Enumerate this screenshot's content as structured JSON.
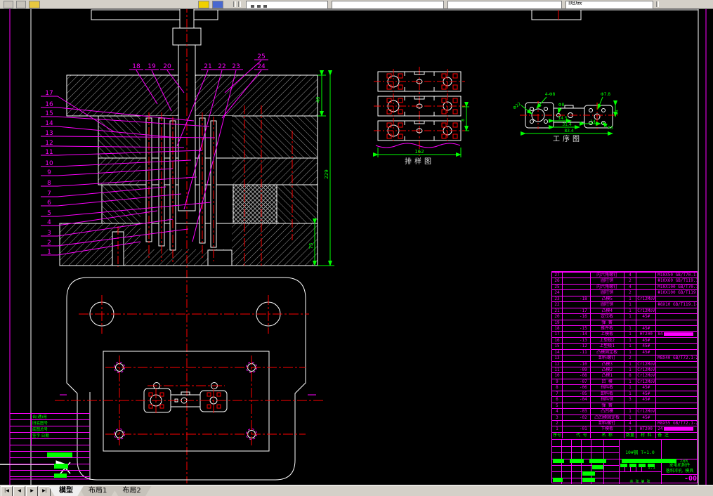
{
  "toolbar": {
    "combo_text": "随层",
    "icons": [
      "toolbar-icon",
      "toolbar-icon",
      "paint-icon",
      "match-icon",
      "preview-icon"
    ]
  },
  "tab_bar": {
    "nav": [
      "|◀",
      "◀",
      "▶",
      "▶|"
    ],
    "tabs": [
      "模型",
      "布局1",
      "布局2"
    ],
    "active_tab": "模型"
  },
  "drawing": {
    "balloons_left": [
      "17",
      "16",
      "15",
      "14",
      "13",
      "12",
      "11",
      "10",
      "9",
      "8",
      "7",
      "6",
      "5",
      "4",
      "3",
      "2",
      "1"
    ],
    "balloons_top": [
      "18",
      "19",
      "20",
      "21",
      "22",
      "23",
      "24",
      "25"
    ],
    "main_dims": {
      "top": "40",
      "overall": "229",
      "bottom": "75"
    },
    "strip_view": {
      "label": "排样图",
      "width_dim": "162",
      "right_dim": "8"
    },
    "process_view": {
      "label": "工序图",
      "dims": {
        "holes": "4-Φ8",
        "left_dia": "Φ22",
        "mid_dia": "Φ8",
        "right_dia": "Φ7.8",
        "d1": "14.5",
        "d2": "31.4",
        "d3": "83.4",
        "d4": "14",
        "radius": "R5",
        "height": "13"
      }
    },
    "bom": {
      "headers": [
        "序号",
        "代 号",
        "名 称",
        "数量",
        "材 料",
        "备 注"
      ],
      "rows": [
        {
          "no": "27",
          "code": "",
          "name": "内六角螺钉",
          "qty": "4",
          "mat": "",
          "remark": "M10X50 GB/T70.1-2000",
          "hl": false
        },
        {
          "no": "26",
          "code": "",
          "name": "圆柱销",
          "qty": "2",
          "mat": "",
          "remark": "Φ10X60 GB/T119.1-2000",
          "hl": false
        },
        {
          "no": "25",
          "code": "",
          "name": "内六角螺钉",
          "qty": "4",
          "mat": "",
          "remark": "M10X100 GB/T70.1-2000",
          "hl": false
        },
        {
          "no": "24",
          "code": "",
          "name": "圆柱销",
          "qty": "2",
          "mat": "",
          "remark": "Φ10X100 GB/T119.1-2000",
          "hl": false
        },
        {
          "no": "23",
          "code": "-18",
          "name": "凸模5",
          "qty": "1",
          "mat": "Cr12MoV",
          "remark": "",
          "hl": false
        },
        {
          "no": "22",
          "code": "",
          "name": "圆柱销",
          "qty": "1",
          "mat": "",
          "remark": "Φ8X10 GB/T119.1-2000",
          "hl": false
        },
        {
          "no": "21",
          "code": "-17",
          "name": "凸模4",
          "qty": "1",
          "mat": "Cr12MoV",
          "remark": "",
          "hl": false
        },
        {
          "no": "20",
          "code": "-16",
          "name": "定位板",
          "qty": "1",
          "mat": "45#",
          "remark": "",
          "hl": false
        },
        {
          "no": "19",
          "code": "",
          "name": "弹  簧",
          "qty": "",
          "mat": "",
          "remark": "",
          "hl": false
        },
        {
          "no": "18",
          "code": "-15",
          "name": "推件板",
          "qty": "1",
          "mat": "45#",
          "remark": "",
          "hl": false
        },
        {
          "no": "17",
          "code": "-14",
          "name": "上模板",
          "qty": "1",
          "mat": "HT200",
          "remark": "84",
          "hl": true
        },
        {
          "no": "16",
          "code": "-13",
          "name": "上垫板2",
          "qty": "1",
          "mat": "45#",
          "remark": "",
          "hl": false
        },
        {
          "no": "15",
          "code": "-12",
          "name": "上垫板1",
          "qty": "1",
          "mat": "45#",
          "remark": "",
          "hl": false
        },
        {
          "no": "14",
          "code": "-11",
          "name": "凸模固定板",
          "qty": "1",
          "mat": "45#",
          "remark": "",
          "hl": false
        },
        {
          "no": "13",
          "code": "",
          "name": "卸料螺钉",
          "qty": "2",
          "mat": "",
          "remark": "M8X40 GB/T72.1-2000",
          "hl": false
        },
        {
          "no": "12",
          "code": "-10",
          "name": "凸模3",
          "qty": "1",
          "mat": "Cr12MoV",
          "remark": "",
          "hl": false
        },
        {
          "no": "11",
          "code": "-09",
          "name": "凸模2",
          "qty": "1",
          "mat": "Cr12MoV",
          "remark": "",
          "hl": false
        },
        {
          "no": "10",
          "code": "-08",
          "name": "凸模1",
          "qty": "8",
          "mat": "Cr12MoV",
          "remark": "",
          "hl": false
        },
        {
          "no": "9",
          "code": "-07",
          "name": "凹  模",
          "qty": "1",
          "mat": "Cr12MoV",
          "remark": "",
          "hl": false
        },
        {
          "no": "8",
          "code": "-06",
          "name": "挡料板",
          "qty": "1",
          "mat": "45#",
          "remark": "",
          "hl": false
        },
        {
          "no": "7",
          "code": "-05",
          "name": "卸料板",
          "qty": "1",
          "mat": "45#",
          "remark": "",
          "hl": false
        },
        {
          "no": "6",
          "code": "-04",
          "name": "挡料销",
          "qty": "3",
          "mat": "45#",
          "remark": "",
          "hl": false
        },
        {
          "no": "5",
          "code": "",
          "name": "弹  簧",
          "qty": "",
          "mat": "",
          "remark": "",
          "hl": false
        },
        {
          "no": "4",
          "code": "-03",
          "name": "凸凹模",
          "qty": "1",
          "mat": "Cr12MoV",
          "remark": "",
          "hl": false
        },
        {
          "no": "3",
          "code": "-02",
          "name": "凸凹模固定板",
          "qty": "1",
          "mat": "45#",
          "remark": "",
          "hl": false
        },
        {
          "no": "2",
          "code": "",
          "name": "卸料螺钉",
          "qty": "4",
          "mat": "",
          "remark": "M8X55 GB/T72.1-2000",
          "hl": false
        },
        {
          "no": "1",
          "code": "-01",
          "name": "下模板",
          "qty": "1",
          "mat": "HT200",
          "remark": "24",
          "hl": true
        }
      ]
    },
    "title_block": {
      "material_spec": "10#钢  T=1.0",
      "scale": "1:1",
      "date": "2月8",
      "sheet_note": "共 张 第 张",
      "product_line1": "发电机附件",
      "product_line2": "落料冲孔 模具",
      "drawing_no": "-00"
    },
    "side_table": {
      "rows": [
        "合(通)用",
        "旧底图号",
        "底图总号",
        "签字 日期"
      ]
    }
  }
}
